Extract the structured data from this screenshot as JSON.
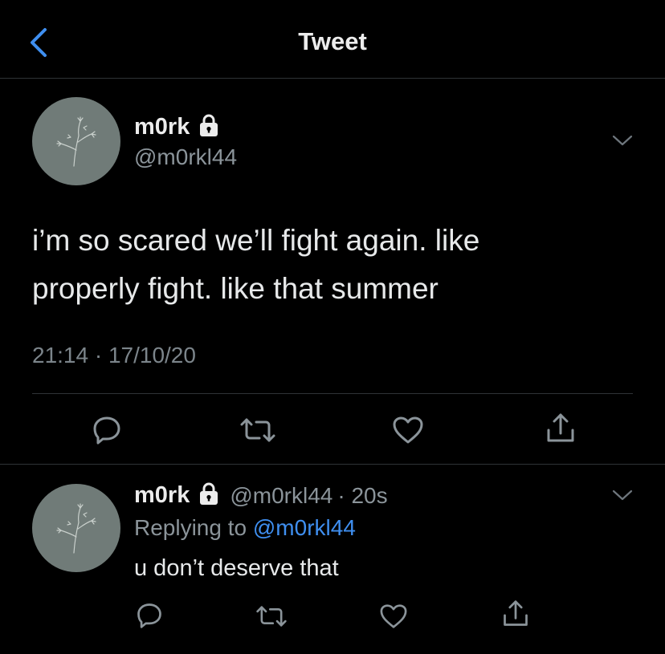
{
  "header": {
    "title": "Tweet",
    "back_icon": "chevron-left-icon",
    "accent": "#3f8ff0"
  },
  "tweet": {
    "author_name": "m0rk",
    "author_handle": "@m0rkl44",
    "text_line1": "i’m so scared we’ll fight again. like",
    "text_line2": "properly fight. like that summer",
    "time": "21:14 · 17/10/20",
    "actions": [
      "reply-icon",
      "retweet-icon",
      "like-icon",
      "share-icon"
    ]
  },
  "reply": {
    "author_name": "m0rk",
    "author_handle": "@m0rkl44",
    "time_ago": "· 20s",
    "replying_prefix": "Replying to ",
    "replying_to": "@m0rkl44",
    "text": "u don’t deserve that",
    "actions": [
      "reply-icon",
      "retweet-icon",
      "like-icon",
      "share-icon"
    ]
  },
  "colors": {
    "background": "#000000",
    "divider": "#2f3336",
    "secondary_text": "#8b949a",
    "link": "#3f8ff0",
    "avatar": "#707b78"
  }
}
